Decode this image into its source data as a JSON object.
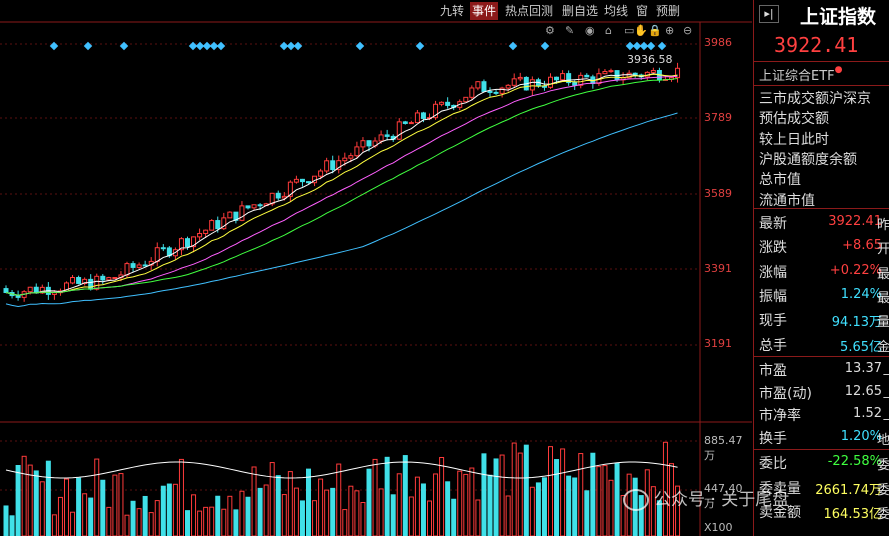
{
  "toolbar": {
    "buttons": [
      "九转",
      "事件",
      "热点回测",
      "删自选",
      "均线",
      "窗",
      "预删"
    ]
  },
  "chart": {
    "price_axis": [
      "3986",
      "3789",
      "3589",
      "3391",
      "3191"
    ],
    "high_label": "3936.58",
    "vol_axis": [
      "885.47万",
      "447.40万",
      "X100"
    ]
  },
  "panel": {
    "title": "上证指数",
    "price": "3922.41",
    "etf": "上证综合ETF",
    "labels": [
      "三市成交额沪深京",
      "预估成交额",
      "较上日此时",
      "沪股通额度余额",
      "总市值",
      "流通市值"
    ],
    "quotes1": [
      {
        "k": "最新",
        "v": "3922.41",
        "s": "昨"
      },
      {
        "k": "涨跌",
        "v": "+8.65",
        "s": "开"
      },
      {
        "k": "涨幅",
        "v": "+0.22%",
        "s": "最"
      },
      {
        "k": "振幅",
        "v": "1.24%",
        "s": "最"
      },
      {
        "k": "现手",
        "v": "94.13万",
        "s": "量"
      },
      {
        "k": "总手",
        "v": "5.65亿",
        "s": "金"
      }
    ],
    "quotes2": [
      {
        "k": "市盈",
        "v": "13.37",
        "s": "_"
      },
      {
        "k": "市盈(动)",
        "v": "12.65",
        "s": "_"
      },
      {
        "k": "市净率",
        "v": "1.52",
        "s": "_"
      },
      {
        "k": "换手",
        "v": "1.20%",
        "s": "地"
      }
    ],
    "quotes3": [
      {
        "k": "委比",
        "v": "-22.58%",
        "s": "委"
      },
      {
        "k": "委卖量",
        "v": "2661.74万",
        "s": "委"
      },
      {
        "k": "卖金额",
        "v": "164.53亿",
        "s": "委"
      }
    ]
  },
  "watermark": "公众号 · 关于尾盘",
  "colors": {
    "up": "#ff3b3b",
    "down": "#40e0e8",
    "ma5": "#ffffff",
    "ma10": "#ffff40",
    "ma20": "#ff60ff",
    "ma30": "#40ff40",
    "ma60": "#40c0ff"
  }
}
